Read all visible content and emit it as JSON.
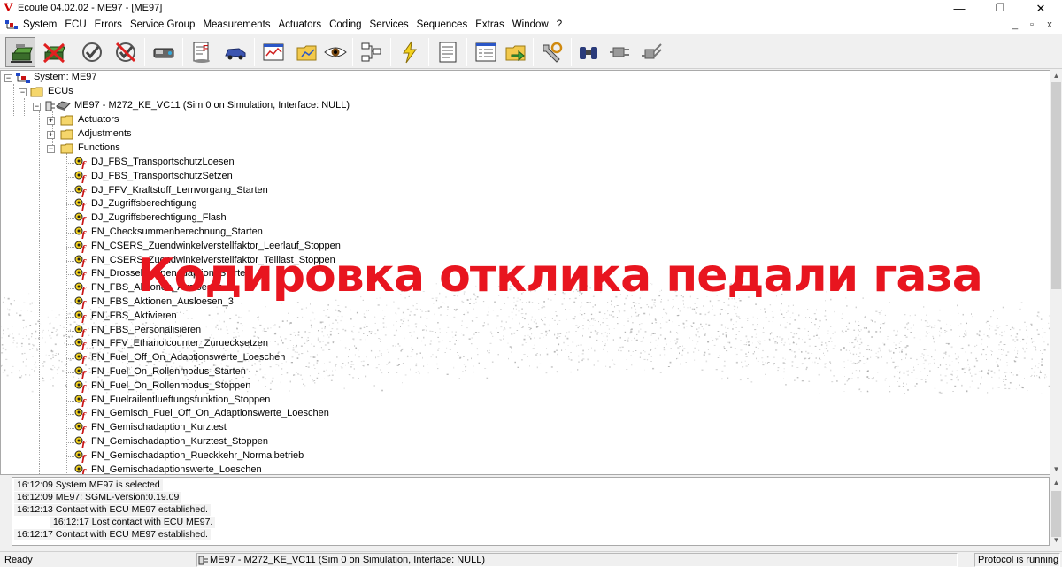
{
  "window": {
    "title": "Ecoute 04.02.02 - ME97 - [ME97]",
    "logo_letter": "V",
    "minimize": "—",
    "maximize": "❐",
    "close": "✕"
  },
  "menubar": {
    "items": [
      "System",
      "ECU",
      "Errors",
      "Service Group",
      "Measurements",
      "Actuators",
      "Coding",
      "Services",
      "Sequences",
      "Extras",
      "Window",
      "?"
    ],
    "mdi_minimize": "_",
    "mdi_restore": "▫",
    "mdi_close": "x"
  },
  "toolbar": {
    "buttons": [
      {
        "icon": "connect-ecu-icon",
        "active": true
      },
      {
        "icon": "disconnect-ecu-icon"
      },
      {
        "icon": "check-icon"
      },
      {
        "icon": "no-check-icon"
      },
      {
        "icon": "interface-icon"
      },
      {
        "icon": "errors-report-icon"
      },
      {
        "icon": "vehicle-icon"
      },
      {
        "icon": "measurement-window-icon"
      },
      {
        "icon": "folder-chart-icon"
      },
      {
        "icon": "eye-icon"
      },
      {
        "icon": "tree-structure-icon"
      },
      {
        "icon": "flash-icon"
      },
      {
        "icon": "document-icon"
      },
      {
        "icon": "checklist-icon"
      },
      {
        "icon": "folder-export-icon"
      },
      {
        "icon": "tools-icon"
      },
      {
        "icon": "binoculars-icon"
      },
      {
        "icon": "plug-icon"
      },
      {
        "icon": "plug-disabled-icon"
      }
    ]
  },
  "tree": {
    "system": "System: ME97",
    "ecus": "ECUs",
    "ecu": "ME97 - M272_KE_VC11 (Sim 0 on Simulation, Interface: NULL)",
    "folders": [
      "Actuators",
      "Adjustments",
      "Functions"
    ],
    "functions": [
      "DJ_FBS_TransportschutzLoesen",
      "DJ_FBS_TransportschutzSetzen",
      "DJ_FFV_Kraftstoff_Lernvorgang_Starten",
      "DJ_Zugriffsberechtigung",
      "DJ_Zugriffsberechtigung_Flash",
      "FN_Checksummenberechnung_Starten",
      "FN_CSERS_Zuendwinkelverstellfaktor_Leerlauf_Stoppen",
      "FN_CSERS_Zuendwinkelverstellfaktor_Teillast_Stoppen",
      "FN_Drosselklappenadaption_Starten",
      "FN_FBS_Aktionen_Ausloesen",
      "FN_FBS_Aktionen_Ausloesen_3",
      "FN_FBS_Aktivieren",
      "FN_FBS_Personalisieren",
      "FN_FFV_Ethanolcounter_Zuruecksetzen",
      "FN_Fuel_Off_On_Adaptionswerte_Loeschen",
      "FN_Fuel_On_Rollenmodus_Starten",
      "FN_Fuel_On_Rollenmodus_Stoppen",
      "FN_Fuelrailentlueftungsfunktion_Stoppen",
      "FN_Gemisch_Fuel_Off_On_Adaptionswerte_Loeschen",
      "FN_Gemischadaption_Kurztest",
      "FN_Gemischadaption_Kurztest_Stoppen",
      "FN_Gemischadaption_Rueckkehr_Normalbetrieb",
      "FN_Gemischadaptionswerte_Loeschen"
    ]
  },
  "overlay": {
    "text": "Кодировка отклика педали газа"
  },
  "log": {
    "lines": [
      "16:12:09 System ME97 is selected",
      "16:12:09 ME97: SGML-Version:0.19.09",
      "16:12:13 Contact with ECU ME97 established.",
      "16:12:17 Lost contact with ECU ME97.",
      "16:12:17 Contact with ECU ME97 established."
    ]
  },
  "status": {
    "ready": "Ready",
    "ecu": "ME97 - M272_KE_VC11 (Sim 0 on Simulation, Interface: NULL)",
    "protocol": "Protocol is running"
  },
  "colors": {
    "overlay_text": "#e8151f",
    "logo": "#d00000",
    "folder": "#f5d66b"
  }
}
